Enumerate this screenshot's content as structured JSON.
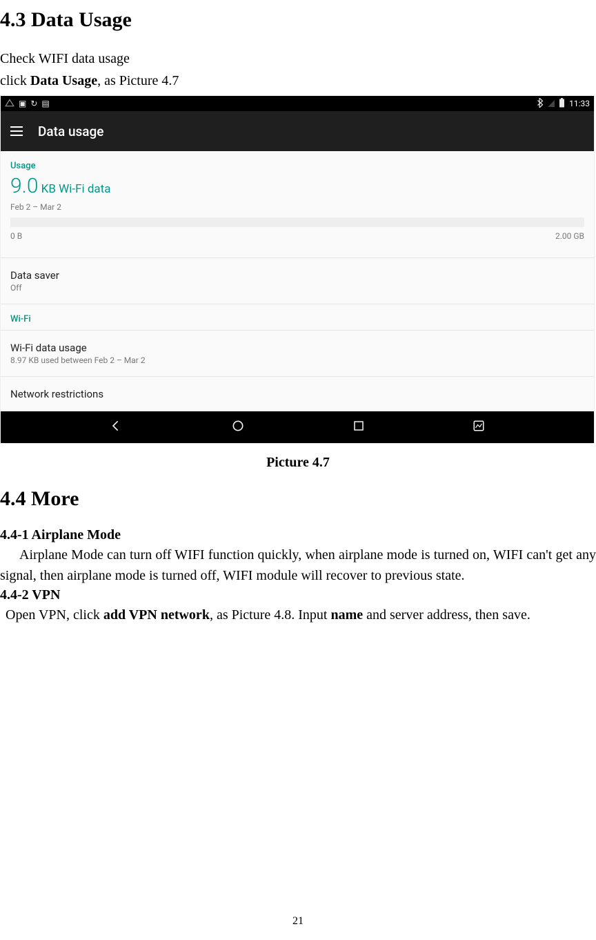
{
  "section": {
    "title_43": "4.3 Data Usage",
    "intro1": "Check WIFI data usage",
    "intro2_pre": "click ",
    "intro2_bold": "Data Usage",
    "intro2_post": ", as Picture 4.7",
    "caption": "Picture 4.7",
    "title_44": "4.4 More",
    "h_441": "4.4-1 Airplane Mode",
    "p_441": "Airplane Mode can turn off WIFI function quickly, when airplane mode is turned on, WIFI can't get any signal, then airplane mode is turned off, WIFI module will recover to previous state.",
    "h_442": "4.4-2 VPN",
    "p_442_pre": "Open VPN, click ",
    "p_442_b1": "add VPN network",
    "p_442_mid": ", as Picture 4.8. Input ",
    "p_442_b2": "name",
    "p_442_post": " and server address, then save.",
    "page_num": "21"
  },
  "screenshot": {
    "statusbar": {
      "time": "11:33"
    },
    "appbar": {
      "title": "Data usage"
    },
    "usage": {
      "header": "Usage",
      "value_big": "9.0",
      "value_rest": " KB Wi-Fi data",
      "date_range": "Feb 2 – Mar 2",
      "min": "0 B",
      "max": "2.00 GB"
    },
    "rows": {
      "data_saver": {
        "title": "Data saver",
        "sub": "Off"
      },
      "wifi_header": "Wi-Fi",
      "wifi_usage": {
        "title": "Wi-Fi data usage",
        "sub": "8.97 KB used between Feb 2 – Mar 2"
      },
      "net_restrict": {
        "title": "Network restrictions"
      }
    }
  }
}
